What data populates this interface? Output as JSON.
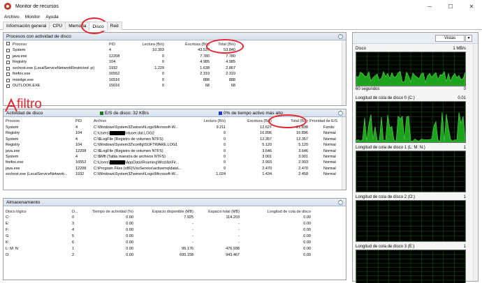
{
  "window": {
    "title": "Monitor de recursos",
    "minimize_glyph": "─",
    "maximize_glyph": "☐",
    "close_glyph": "✕"
  },
  "menu": [
    "Archivo",
    "Monitor",
    "Ayuda"
  ],
  "tabs": [
    "Información general",
    "CPU",
    "Memoria",
    "Disco",
    "Red"
  ],
  "active_tab": "Disco",
  "processes_panel": {
    "title": "Procesos con actividad de disco",
    "columns": [
      "Proceso",
      "PID",
      "Lectura (B/s)",
      "Escritura (B/s)",
      "Total (B/s)"
    ],
    "rows": [
      [
        "System",
        "4",
        "10.303",
        "43.537",
        "53.840"
      ],
      [
        "java.exe",
        "12208",
        "0",
        "7.780",
        "7.780"
      ],
      [
        "Registry",
        "104",
        "0",
        "4.985",
        "4.985"
      ],
      [
        "svchost.exe (LocalServiceNetworkRestricted -p)",
        "1932",
        "1.229",
        "1.638",
        "2.867"
      ],
      [
        "firefox.exe",
        "16552",
        "0",
        "2.319",
        "2.319"
      ],
      [
        "msedge.exe",
        "16516",
        "0",
        "888",
        "888"
      ],
      [
        "OUTLOOK.EXE",
        "15016",
        "0",
        "68",
        "68"
      ]
    ]
  },
  "activity_panel": {
    "title": "Actividad de disco",
    "stat1": "E/S de disco: 32 KB/s",
    "stat2": "0% de tiempo activo más alto",
    "columns": [
      "Proceso",
      "PID",
      "Archivo",
      "Lectura (B/s)",
      "Escritura (B/s)",
      "Total (B/s)",
      "Prioridad de E/S"
    ],
    "rows": [
      [
        "System",
        "4",
        "C:\\Windows\\System32\\winevt\\Logs\\Microsoft-W...",
        "9.211",
        "12.627",
        "21.838",
        "Fondo"
      ],
      [
        "Registry",
        "104",
        "C:\\Users\\████\\ntuser.dat.LOG2",
        "0",
        "16.896",
        "16.896",
        "Normal"
      ],
      [
        "System",
        "4",
        "C:\\$LogFile (Registro de volumen NTFS)",
        "0",
        "12.357",
        "12.357",
        "Normal"
      ],
      [
        "Registry",
        "104",
        "C:\\Windows\\System32\\config\\SOFTWARE.LOG1",
        "0",
        "5.120",
        "5.120",
        "Normal"
      ],
      [
        "java.exe",
        "12208",
        "C:\\$LogFile (Registro de volumen NTFS)",
        "0",
        "3.646",
        "3.646",
        "Normal"
      ],
      [
        "System",
        "4",
        "C:\\$Mft (Tabla maestra de archivos NTFS)",
        "0",
        "3.001",
        "3.001",
        "Normal"
      ],
      [
        "firefox.exe",
        "16552",
        "C:\\Users\\████\\AppData\\Roaming\\Mozilla\\Fir...",
        "0",
        "2.993",
        "2.993",
        "Normal"
      ],
      [
        "java.exe",
        "12208",
        "C:\\Program Files (x86)\\VssService\\activemq\\data\\...",
        "0",
        "2.470",
        "2.470",
        "Normal"
      ],
      [
        "svchost.exe (LocalServiceNetwork...",
        "1932",
        "C:\\Windows\\System32\\winevt\\Logs\\Microsoft-W...",
        "1.024",
        "1.434",
        "2.458",
        "Normal"
      ]
    ]
  },
  "storage_panel": {
    "title": "Almacenamiento",
    "columns": [
      "Disco lógico",
      "D...",
      "Tiempo de actividad (%)",
      "Espacio disponible (MB)",
      "Espacio total (MB)",
      "Longitud de cola de disco"
    ],
    "rows": [
      [
        "C:",
        "0",
        "0.00",
        "7.925",
        "114.203",
        "0.00"
      ],
      [
        "E:",
        "3",
        "0.00",
        "-",
        "-",
        "0.00"
      ],
      [
        "F:",
        "4",
        "0.00",
        "-",
        "-",
        "0.00"
      ],
      [
        "G:",
        "5",
        "0.00",
        "-",
        "-",
        "0.00"
      ],
      [
        "K:",
        "6",
        "0.00",
        "-",
        "-",
        "0.00"
      ],
      [
        "L: M: N:",
        "1",
        "0.00",
        "95.176",
        "476.938",
        "0.00"
      ],
      [
        "O:",
        "2",
        "0.00",
        "695.158",
        "943.467",
        "0.00"
      ]
    ]
  },
  "right_pane": {
    "views_label": "Vistas",
    "graphs": [
      {
        "label": "Disco",
        "right_label": "1 MB/s",
        "footer": "60 segundos",
        "footer_right": "0"
      },
      {
        "label": "Longitud de cola de disco 0 (C:)",
        "right_label": "0.01",
        "footer": "",
        "footer_right": ""
      },
      {
        "label": "Longitud de cola de disco 1 (L: M: N:)",
        "right_label": "1",
        "footer": "",
        "footer_right": ""
      },
      {
        "label": "Longitud de cola de disco 2 (O:)",
        "right_label": "1",
        "footer": "",
        "footer_right": ""
      },
      {
        "label": "Longitud de cola de disco 3 (E:)",
        "right_label": "1",
        "footer": "",
        "footer_right": ""
      }
    ]
  },
  "annotation": {
    "text": "filtro",
    "color": "#e3262f"
  }
}
